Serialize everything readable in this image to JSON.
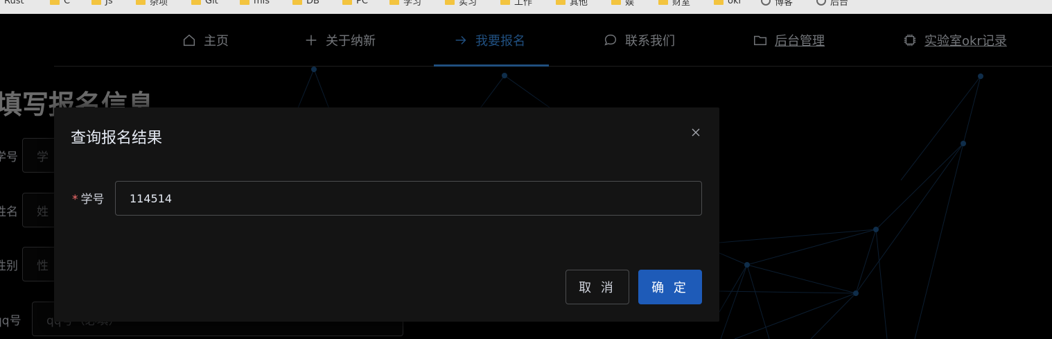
{
  "bookmarks": [
    {
      "label": "Rust",
      "type": "folder"
    },
    {
      "label": "C",
      "type": "folder"
    },
    {
      "label": "Js",
      "type": "folder"
    },
    {
      "label": "杂项",
      "type": "folder"
    },
    {
      "label": "Git",
      "type": "folder"
    },
    {
      "label": "mis",
      "type": "folder"
    },
    {
      "label": "DB",
      "type": "folder"
    },
    {
      "label": "PC",
      "type": "folder"
    },
    {
      "label": "学习",
      "type": "folder"
    },
    {
      "label": "实习",
      "type": "folder"
    },
    {
      "label": "工作",
      "type": "folder"
    },
    {
      "label": "其他",
      "type": "folder"
    },
    {
      "label": "娱",
      "type": "folder"
    },
    {
      "label": "财室",
      "type": "folder"
    },
    {
      "label": "okr",
      "type": "folder"
    },
    {
      "label": "博客",
      "type": "site"
    },
    {
      "label": "后台",
      "type": "site"
    }
  ],
  "nav": {
    "items": [
      {
        "label": "主页",
        "icon": "home-icon"
      },
      {
        "label": "关于纳新",
        "icon": "plus-icon"
      },
      {
        "label": "我要报名",
        "icon": "arrow-right-icon",
        "active": true
      },
      {
        "label": "联系我们",
        "icon": "chat-bubble-icon"
      },
      {
        "label": "后台管理",
        "icon": "folder-icon",
        "link": true
      },
      {
        "label": "实验室okr记录",
        "icon": "cpu-icon",
        "link": true
      }
    ]
  },
  "form": {
    "title": "填写报名信息",
    "fields": [
      {
        "label": "学号",
        "placeholder": "学"
      },
      {
        "label": "姓名",
        "placeholder": "姓"
      },
      {
        "label": "性别",
        "placeholder": "性"
      },
      {
        "label": "qq号",
        "placeholder": "qq号（必填）"
      }
    ]
  },
  "dialog": {
    "title": "查询报名结果",
    "field_label": "学号",
    "required_mark": "*",
    "field_value": "114514",
    "cancel_label": "取 消",
    "confirm_label": "确 定"
  },
  "colors": {
    "accent": "#409eff",
    "primary_button": "#1e5bb8",
    "required": "#f56c6c",
    "dialog_bg": "#141414"
  }
}
